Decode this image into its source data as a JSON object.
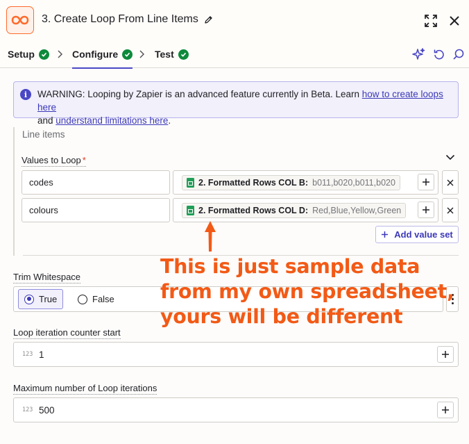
{
  "header": {
    "title": "3. Create Loop From Line Items",
    "app_logo_icon": "zapier-loop-icon",
    "accent": "#ff6a2b"
  },
  "tabs": [
    {
      "label": "Setup",
      "status": "complete"
    },
    {
      "label": "Configure",
      "status": "complete",
      "active": true
    },
    {
      "label": "Test",
      "status": "complete"
    }
  ],
  "toolbar": {
    "icons": [
      "sparkle-icon",
      "refresh-icon",
      "search-icon"
    ]
  },
  "warning": {
    "text_before": "WARNING: Looping by Zapier is an advanced feature currently in Beta. Learn ",
    "link1": "how to create loops here",
    "text_middle": "and ",
    "link2": "understand limitations here",
    "text_after": "."
  },
  "line_items": {
    "group_label": "Line items",
    "values_label": "Values to Loop",
    "rows": [
      {
        "key": "codes",
        "pill_title": "2. Formatted Rows COL B:",
        "pill_sample": "b011,b020,b011,b020"
      },
      {
        "key": "colours",
        "pill_title": "2. Formatted Rows COL D:",
        "pill_sample": "Red,Blue,Yellow,Green"
      }
    ],
    "add_value_set": "Add value set"
  },
  "trim_whitespace": {
    "label": "Trim Whitespace",
    "options": [
      "True",
      "False"
    ],
    "selected": "True"
  },
  "counter_start": {
    "label": "Loop iteration counter start",
    "value": "1",
    "type_icon": "123"
  },
  "max_iterations": {
    "label": "Maximum number of Loop iterations",
    "value": "500",
    "type_icon": "123"
  },
  "annotation": {
    "lines": [
      "This is just sample data",
      "from my own spreadsheet,",
      "yours will be different"
    ],
    "color": "#f25a16"
  }
}
